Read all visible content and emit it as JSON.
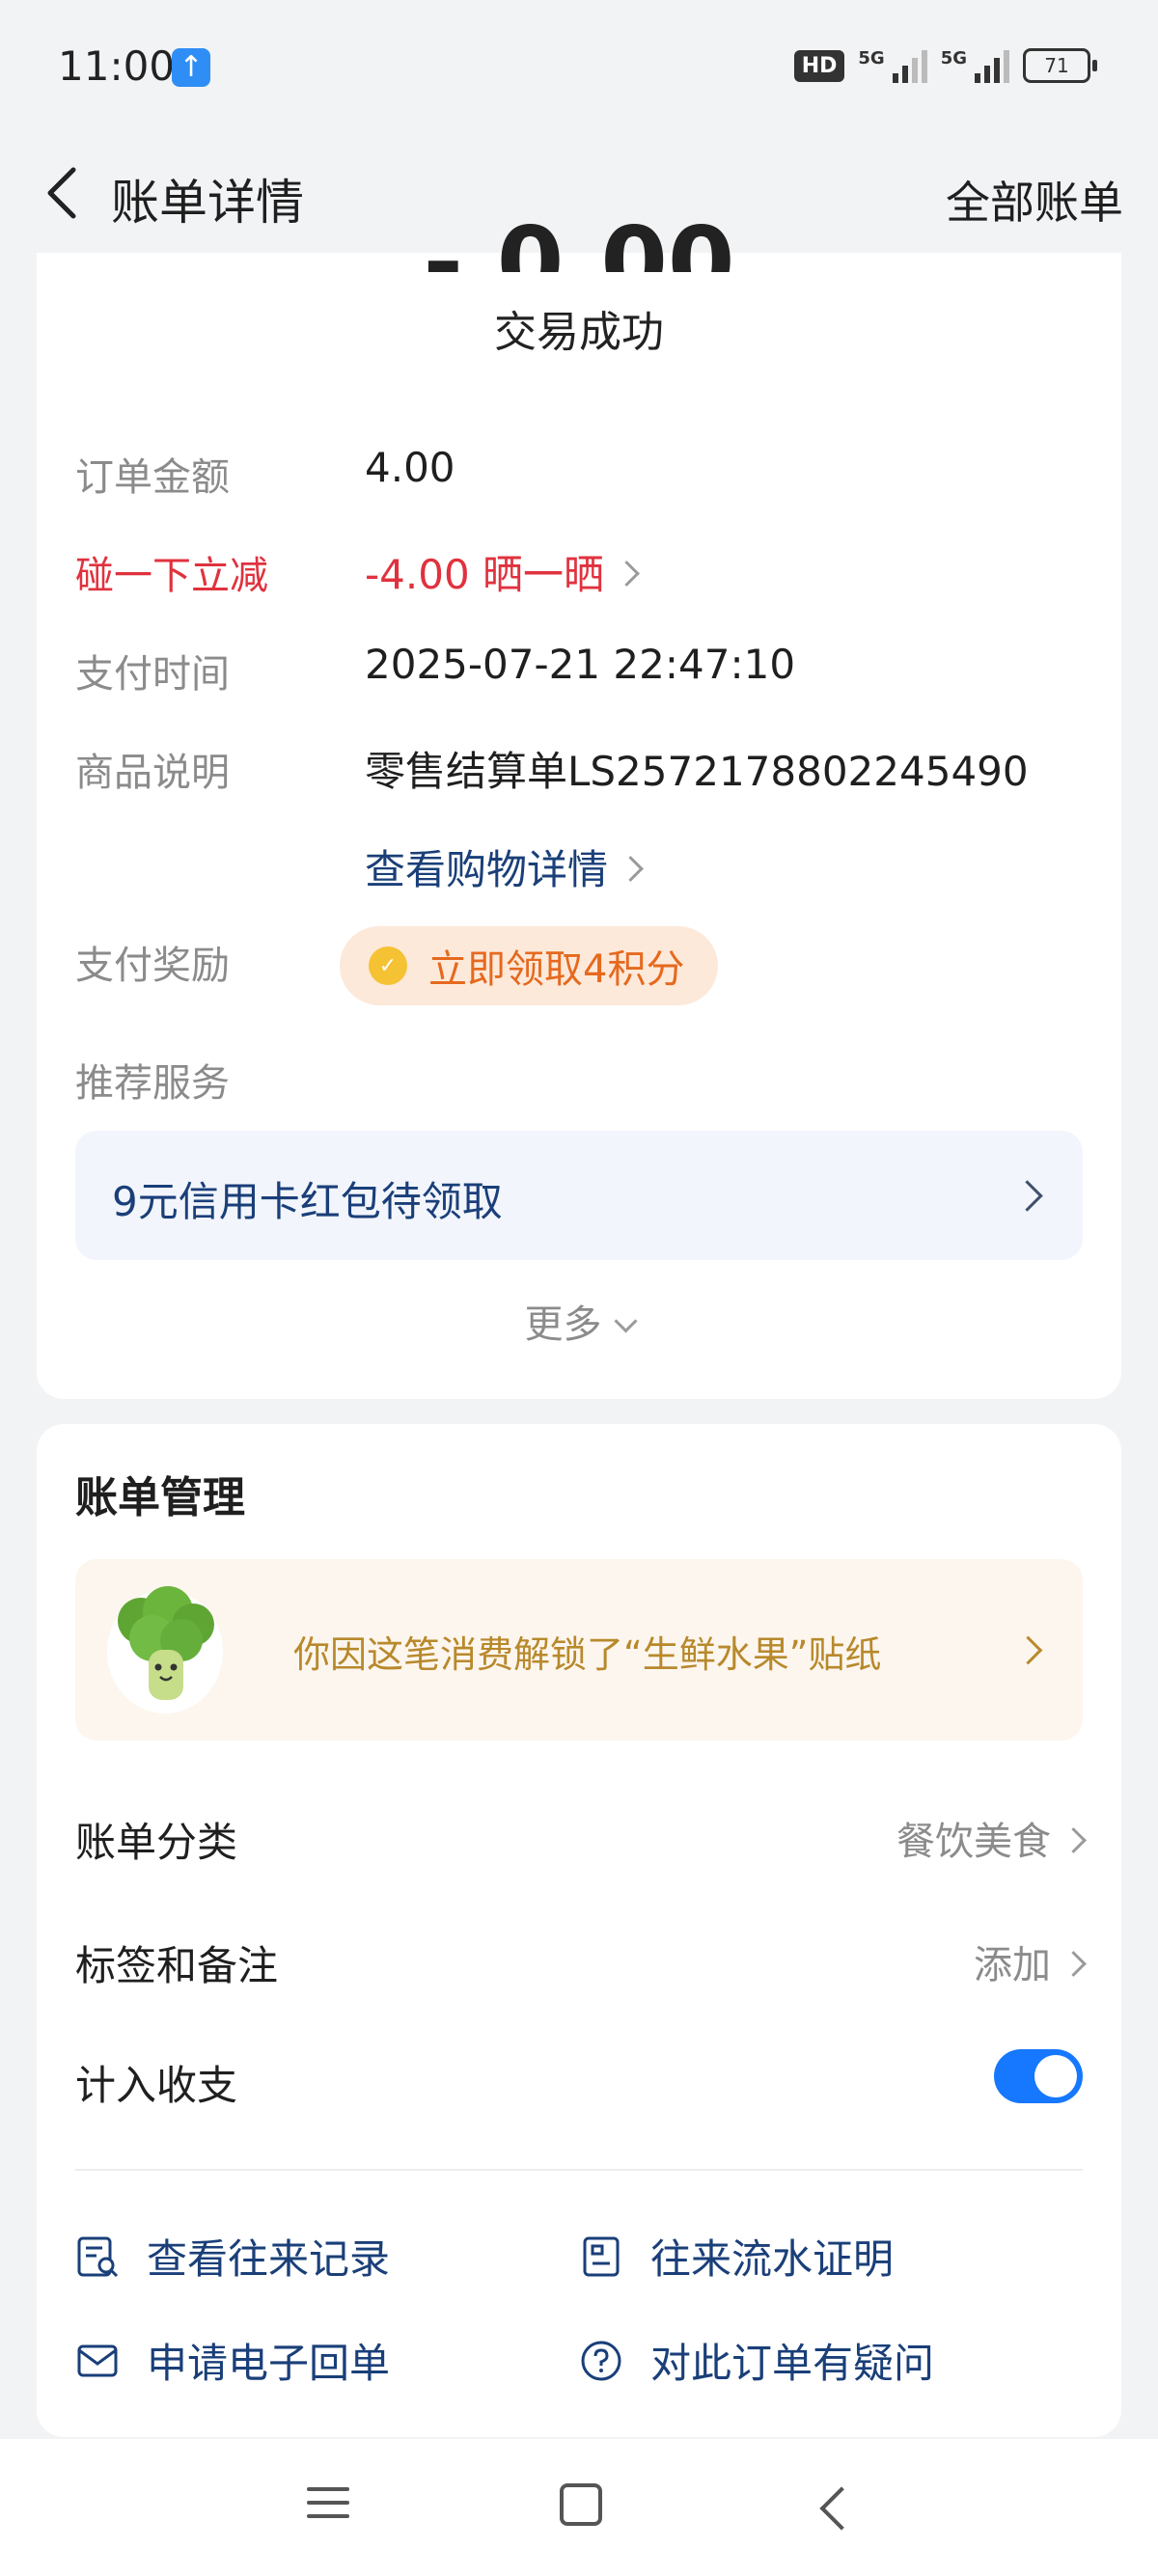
{
  "status_bar": {
    "time": "11:00",
    "up_icon": "upload-arrow-icon",
    "hd_label": "HD",
    "net_1": "5G",
    "net_2": "5G",
    "battery": "71"
  },
  "header": {
    "title": "账单详情",
    "right_link": "全部账单"
  },
  "transaction": {
    "status": "交易成功",
    "rows": {
      "order_amount": {
        "label": "订单金额",
        "value": "4.00"
      },
      "discount": {
        "label": "碰一下立减",
        "value": "-4.00 晒一晒"
      },
      "pay_time": {
        "label": "支付时间",
        "value": "2025-07-21 22:47:10"
      },
      "product": {
        "label": "商品说明",
        "value": "零售结算单LS2572178802245490"
      },
      "shopping_detail": {
        "value": "查看购物详情"
      },
      "reward": {
        "label": "支付奖励",
        "value": "立即领取4积分"
      },
      "recommend": {
        "label": "推荐服务"
      }
    },
    "recommend_item": "9元信用卡红包待领取",
    "more": "更多"
  },
  "management": {
    "title": "账单管理",
    "sticker_text": "你因这笔消费解锁了“生鲜水果”贴纸",
    "category": {
      "label": "账单分类",
      "value": "餐饮美食"
    },
    "tags": {
      "label": "标签和备注",
      "value": "添加"
    },
    "count_in": {
      "label": "计入收支",
      "enabled": true
    },
    "actions": {
      "history": "查看往来记录",
      "proof": "往来流水证明",
      "receipt": "申请电子回单",
      "question": "对此订单有疑问"
    }
  },
  "colors": {
    "accent_blue": "#1677ff",
    "link_navy": "#1a3f79",
    "discount_red": "#e0323e",
    "reward_orange": "#e6691e",
    "sticker_gold": "#b8892c"
  }
}
